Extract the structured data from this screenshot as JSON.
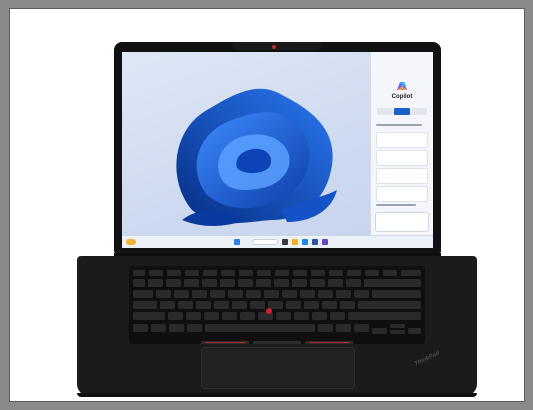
{
  "photo": {
    "subject": "laptop",
    "colors": {
      "background": "#8a8a8a",
      "frame": "#ffffff",
      "chassis": "#1b1b1b",
      "wallpaper_blue": "#1d5fc8",
      "trackpoint": "#d0202a"
    },
    "screen": {
      "copilot_panel": {
        "title": "Copilot"
      }
    },
    "keyboard_logo": "ThinkPad"
  }
}
